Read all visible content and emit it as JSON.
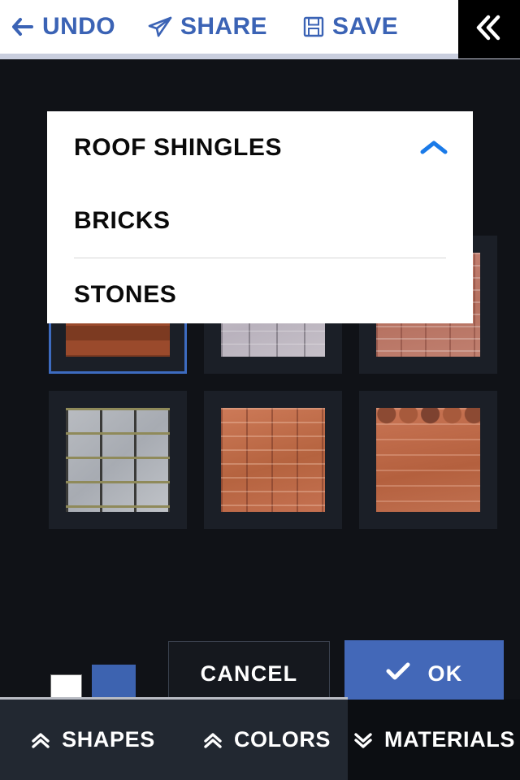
{
  "topbar": {
    "items": [
      {
        "label": "UNDO",
        "icon": "back-arrow-icon"
      },
      {
        "label": "SHARE",
        "icon": "paper-plane-icon"
      },
      {
        "label": "SAVE",
        "icon": "floppy-disk-icon"
      }
    ],
    "collapse_icon": "double-chevron-left-icon",
    "accent_color": "#3b63b5"
  },
  "dropdown": {
    "expanded_icon": "chevron-up-icon",
    "chevron_color": "#1a7ae8",
    "options": [
      {
        "label": "ROOF SHINGLES",
        "selected": true
      },
      {
        "label": "BRICKS",
        "selected": false
      },
      {
        "label": "STONES",
        "selected": false
      }
    ]
  },
  "materials_grid": {
    "tiles": [
      {
        "name": "dark-pantile-roof",
        "texture": "tex-dark-pantile",
        "selected": true
      },
      {
        "name": "grey-brick",
        "texture": "tex-grey-brick",
        "selected": false
      },
      {
        "name": "pink-brick",
        "texture": "tex-pink-brick",
        "selected": false
      },
      {
        "name": "grey-cobblestone",
        "texture": "tex-grey-cobble",
        "selected": false
      },
      {
        "name": "orange-brick",
        "texture": "tex-orange-brick",
        "selected": false
      },
      {
        "name": "scalloped-roof-tile",
        "texture": "tex-scallop",
        "selected": false
      }
    ],
    "selection_color": "#3d6bc0"
  },
  "colors": {
    "swatch_primary": "#ffffff",
    "swatch_secondary": "#3d63b0"
  },
  "actions": {
    "cancel_label": "CANCEL",
    "ok_label": "OK",
    "ok_icon": "check-icon",
    "ok_color": "#4368b8"
  },
  "tabs": [
    {
      "label": "SHAPES",
      "icon": "double-chevron-up-icon",
      "active": false
    },
    {
      "label": "COLORS",
      "icon": "double-chevron-up-icon",
      "active": false
    },
    {
      "label": "MATERIALS",
      "icon": "double-chevron-down-icon",
      "active": true
    }
  ]
}
